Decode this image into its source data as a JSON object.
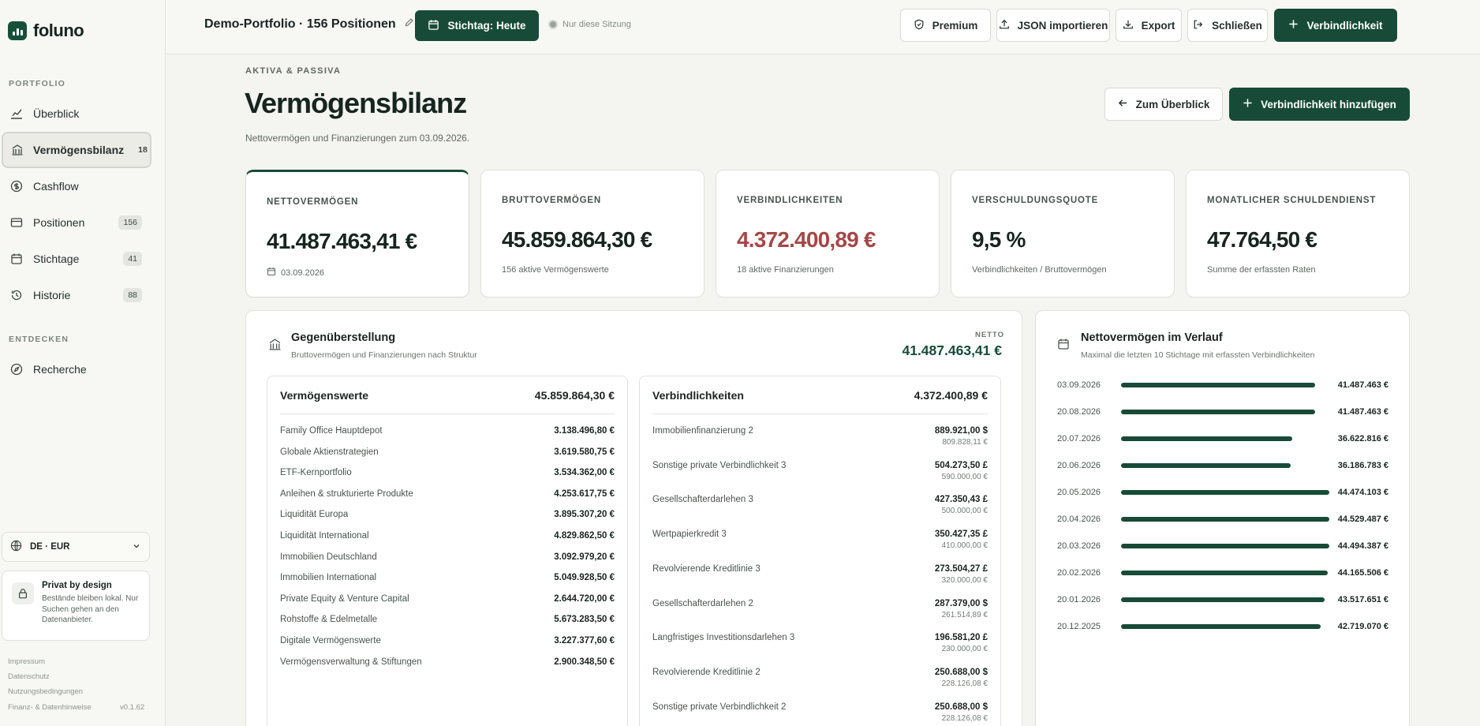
{
  "app": {
    "name": "foluno",
    "brand_color": "#174b37",
    "negative_color": "#a34848"
  },
  "sidebar": {
    "section_portfolio": "PORTFOLIO",
    "items": [
      {
        "label": "Überblick",
        "icon": "chart-line-icon",
        "badge": ""
      },
      {
        "label": "Vermögensbilanz",
        "icon": "bank-icon",
        "badge": "18",
        "active": true
      },
      {
        "label": "Cashflow",
        "icon": "dollar-circle-icon",
        "badge": ""
      },
      {
        "label": "Positionen",
        "icon": "wallet-icon",
        "badge": "156"
      },
      {
        "label": "Stichtage",
        "icon": "calendar-icon",
        "badge": "41"
      },
      {
        "label": "Historie",
        "icon": "history-icon",
        "badge": "88"
      }
    ],
    "section_discover": "ENTDECKEN",
    "discover_items": [
      {
        "label": "Recherche",
        "icon": "compass-icon"
      }
    ],
    "locale": "DE · EUR",
    "privacy_title": "Privat by design",
    "privacy_text": "Bestände bleiben lokal. Nur Suchen gehen an den Datenanbieter.",
    "footer_links": [
      "Impressum",
      "Datenschutz",
      "Nutzungsbedingungen",
      "Finanz- & Datenhinweise"
    ],
    "version": "v0.1.62"
  },
  "topbar": {
    "portfolio_title": "Demo-Portfolio · 156 Positionen",
    "stichtag_button": "Stichtag: Heute",
    "session_note": "Nur diese Sitzung",
    "premium": "Premium",
    "json_import": "JSON importieren",
    "export": "Export",
    "close": "Schließen",
    "add_liability": "Verbindlichkeit"
  },
  "page": {
    "eyebrow": "AKTIVA & PASSIVA",
    "title": "Vermögensbilanz",
    "subtitle": "Nettovermögen und Finanzierungen zum 03.09.2026.",
    "back_button": "Zum Überblick",
    "add_button": "Verbindlichkeit hinzufügen"
  },
  "kpis": [
    {
      "label": "NETTOVERMÖGEN",
      "value": "41.487.463,41 €",
      "sub": "03.09.2026"
    },
    {
      "label": "BRUTTOVERMÖGEN",
      "value": "45.859.864,30 €",
      "sub": "156 aktive Vermögenswerte"
    },
    {
      "label": "VERBINDLICHKEITEN",
      "value": "4.372.400,89 €",
      "sub": "18 aktive Finanzierungen"
    },
    {
      "label": "VERSCHULDUNGSQUOTE",
      "value": "9,5 %",
      "sub": "Verbindlichkeiten / Bruttovermögen"
    },
    {
      "label": "MONATLICHER SCHULDENDIENST",
      "value": "47.764,50 €",
      "sub": "Summe der erfassten Raten"
    }
  ],
  "comparison": {
    "title": "Gegenüberstellung",
    "subtitle": "Bruttovermögen und Finanzierungen nach Struktur",
    "netto_label": "NETTO",
    "netto_value": "41.487.463,41 €",
    "assets": {
      "title": "Vermögenswerte",
      "total": "45.859.864,30 €",
      "rows": [
        {
          "name": "Family Office Hauptdepot",
          "amount": "3.138.496,80 €"
        },
        {
          "name": "Globale Aktienstrategien",
          "amount": "3.619.580,75 €"
        },
        {
          "name": "ETF-Kernportfolio",
          "amount": "3.534.362,00 €"
        },
        {
          "name": "Anleihen & strukturierte Produkte",
          "amount": "4.253.617,75 €"
        },
        {
          "name": "Liquidität Europa",
          "amount": "3.895.307,20 €"
        },
        {
          "name": "Liquidität International",
          "amount": "4.829.862,50 €"
        },
        {
          "name": "Immobilien Deutschland",
          "amount": "3.092.979,20 €"
        },
        {
          "name": "Immobilien International",
          "amount": "5.049.928,50 €"
        },
        {
          "name": "Private Equity & Venture Capital",
          "amount": "2.644.720,00 €"
        },
        {
          "name": "Rohstoffe & Edelmetalle",
          "amount": "5.673.283,50 €"
        },
        {
          "name": "Digitale Vermögenswerte",
          "amount": "3.227.377,60 €"
        },
        {
          "name": "Vermögensverwaltung & Stiftungen",
          "amount": "2.900.348,50 €"
        }
      ]
    },
    "liabilities": {
      "title": "Verbindlichkeiten",
      "total": "4.372.400,89 €",
      "rows": [
        {
          "name": "Immobilienfinanzierung 2",
          "amount": "889.921,00 $",
          "sub": "809.828,11 €"
        },
        {
          "name": "Sonstige private Verbindlichkeit 3",
          "amount": "504.273,50 £",
          "sub": "590.000,00 €"
        },
        {
          "name": "Gesellschafterdarlehen 3",
          "amount": "427.350,43 £",
          "sub": "500.000,00 €"
        },
        {
          "name": "Wertpapierkredit 3",
          "amount": "350.427,35 £",
          "sub": "410.000,00 €"
        },
        {
          "name": "Revolvierende Kreditlinie 3",
          "amount": "273.504,27 £",
          "sub": "320.000,00 €"
        },
        {
          "name": "Gesellschafterdarlehen 2",
          "amount": "287.379,00 $",
          "sub": "261.514,89 €"
        },
        {
          "name": "Langfristiges Investitionsdarlehen 3",
          "amount": "196.581,20 £",
          "sub": "230.000,00 €"
        },
        {
          "name": "Revolvierende Kreditlinie 2",
          "amount": "250.688,00 $",
          "sub": "228.126,08 €"
        },
        {
          "name": "Sonstige private Verbindlichkeit 2",
          "amount": "250.688,00 $",
          "sub": "228.126,08 €"
        }
      ]
    }
  },
  "trend": {
    "title": "Nettovermögen im Verlauf",
    "subtitle": "Maximal die letzten 10 Stichtage mit erfassten Verbindlichkeiten",
    "rows": [
      {
        "date": "03.09.2026",
        "label": "41.487.463 €",
        "value": 41487463
      },
      {
        "date": "20.08.2026",
        "label": "41.487.463 €",
        "value": 41487463
      },
      {
        "date": "20.07.2026",
        "label": "36.622.816 €",
        "value": 36622816
      },
      {
        "date": "20.06.2026",
        "label": "36.186.783 €",
        "value": 36186783
      },
      {
        "date": "20.05.2026",
        "label": "44.474.103 €",
        "value": 44474103
      },
      {
        "date": "20.04.2026",
        "label": "44.529.487 €",
        "value": 44529487
      },
      {
        "date": "20.03.2026",
        "label": "44.494.387 €",
        "value": 44494387
      },
      {
        "date": "20.02.2026",
        "label": "44.165.506 €",
        "value": 44165506
      },
      {
        "date": "20.01.2026",
        "label": "43.517.651 €",
        "value": 43517651
      },
      {
        "date": "20.12.2025",
        "label": "42.719.070 €",
        "value": 42719070
      }
    ]
  }
}
